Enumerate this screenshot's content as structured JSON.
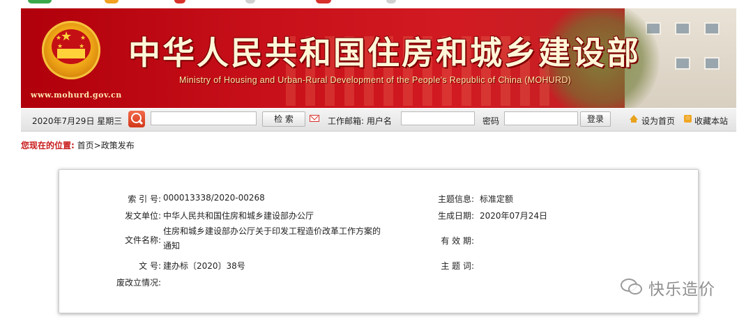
{
  "banner": {
    "title_cn": "中华人民共和国住房和城乡建设部",
    "title_en": "Ministry of Housing and Urban-Rural Development of the People's Republic of China (MOHURD)",
    "site_url": "www.mohurd.gov.cn",
    "emblem_icon": "national-emblem-icon"
  },
  "toolbar": {
    "date_text": "2020年7月29日 星期三",
    "search_icon": "search-icon",
    "search_value": "",
    "search_button": "检  索",
    "mail_icon": "mail-icon",
    "mail_label": "工作邮箱: 用户名",
    "username_value": "",
    "password_label": "密码",
    "password_value": "",
    "login_button": "登录",
    "set_home": "设为首页",
    "bookmark": "收藏本站"
  },
  "breadcrumb": {
    "lead": "您现在的位置:",
    "path": "首页>政策发布"
  },
  "info": {
    "index_label": "索 引 号:",
    "index_value": "000013338/2020-00268",
    "topic_label": "主题信息:",
    "topic_value": "标准定额",
    "issuer_label": "发文单位:",
    "issuer_value": "中华人民共和国住房和城乡建设部办公厅",
    "date_label": "生成日期:",
    "date_value": "2020年07月24日",
    "docname_label": "文件名称:",
    "docname_value": "住房和城乡建设部办公厅关于印发工程造价改革工作方案的通知",
    "validity_label": "有 效 期:",
    "validity_value": "",
    "docno_label": "文      号:",
    "docno_value": "建办标〔2020〕38号",
    "keywords_label": "主 题 词:",
    "keywords_value": "",
    "status_label": "废改立情况:",
    "status_value": ""
  },
  "watermark": {
    "text": "快乐造价",
    "icon": "wechat-icon"
  },
  "colors": {
    "banner_red": "#c8101a",
    "title_cream": "#fff6d8",
    "crumb_red": "#c81a1a",
    "toolbar_gray": "#e8e8e8"
  }
}
